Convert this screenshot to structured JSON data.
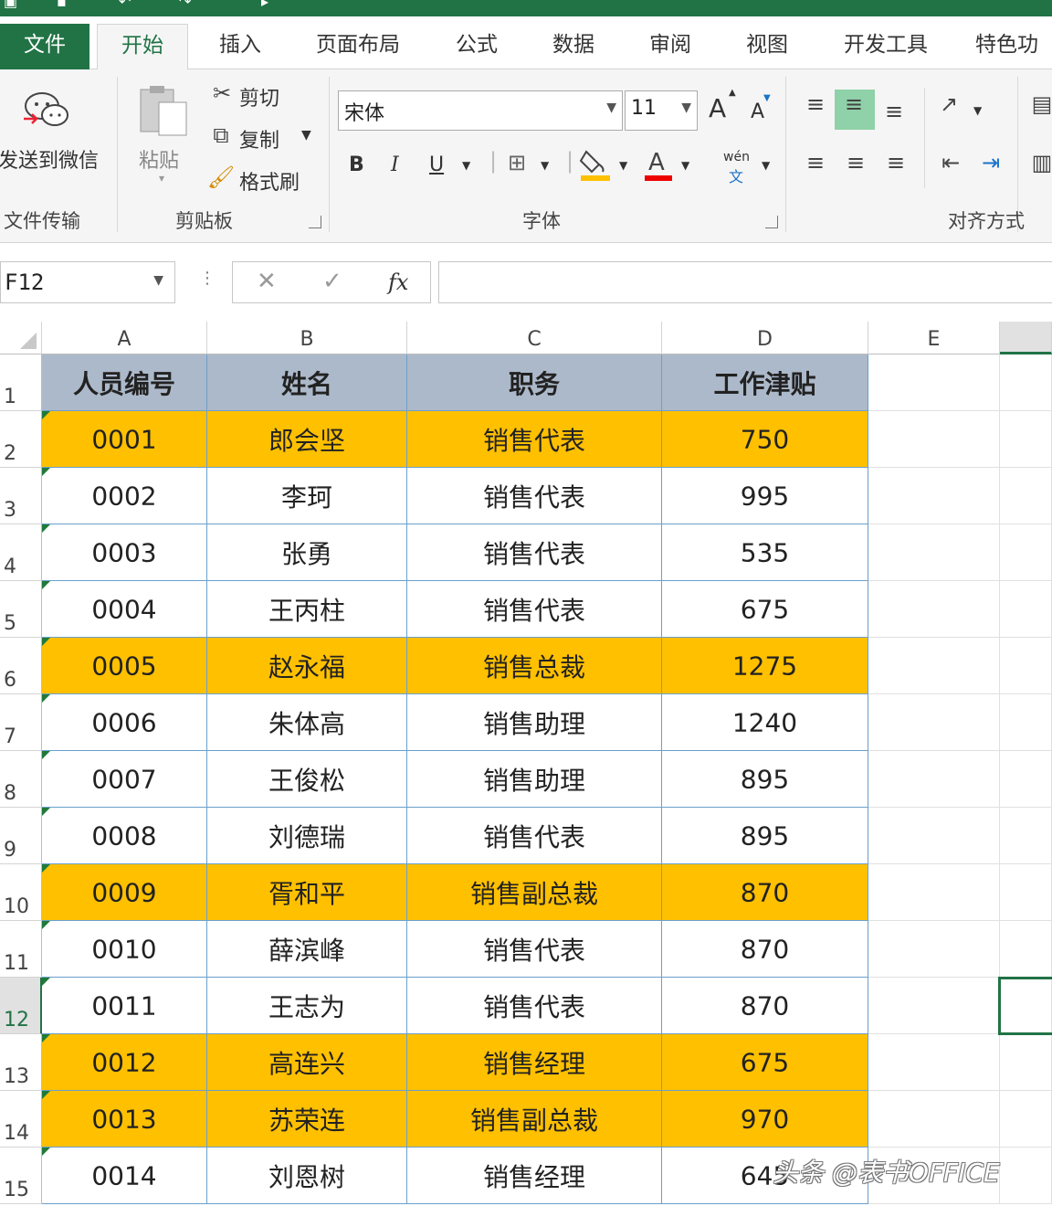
{
  "tabs": {
    "file": "文件",
    "items": [
      "开始",
      "插入",
      "页面布局",
      "公式",
      "数据",
      "审阅",
      "视图",
      "开发工具",
      "特色功"
    ]
  },
  "ribbon": {
    "wechat_label": "发送到微信",
    "wechat_group": "文件传输",
    "paste_label": "粘贴",
    "cut_label": "剪切",
    "copy_label": "复制",
    "format_painter_label": "格式刷",
    "clipboard_group": "剪贴板",
    "font_name": "宋体",
    "font_size": "11",
    "font_group": "字体",
    "align_group": "对齐方式",
    "bold": "B",
    "italic": "I",
    "underline": "U",
    "font_color_glyph": "A",
    "wen_label": "wén",
    "wen_char": "文",
    "grow_font": "A",
    "shrink_font": "A"
  },
  "formula_bar": {
    "name_box": "F12",
    "fx": "fx",
    "formula": ""
  },
  "columns": [
    "A",
    "B",
    "C",
    "D",
    "E"
  ],
  "rows": [
    "1",
    "2",
    "3",
    "4",
    "5",
    "6",
    "7",
    "8",
    "9",
    "10",
    "11",
    "12",
    "13",
    "14",
    "15"
  ],
  "table": {
    "headers": [
      "人员编号",
      "姓名",
      "职务",
      "工作津贴"
    ],
    "data": [
      {
        "id": "0001",
        "name": "郎会坚",
        "role": "销售代表",
        "allowance": "750",
        "highlight": true
      },
      {
        "id": "0002",
        "name": "李珂",
        "role": "销售代表",
        "allowance": "995",
        "highlight": false
      },
      {
        "id": "0003",
        "name": "张勇",
        "role": "销售代表",
        "allowance": "535",
        "highlight": false
      },
      {
        "id": "0004",
        "name": "王丙柱",
        "role": "销售代表",
        "allowance": "675",
        "highlight": false
      },
      {
        "id": "0005",
        "name": "赵永福",
        "role": "销售总裁",
        "allowance": "1275",
        "highlight": true
      },
      {
        "id": "0006",
        "name": "朱体高",
        "role": "销售助理",
        "allowance": "1240",
        "highlight": false
      },
      {
        "id": "0007",
        "name": "王俊松",
        "role": "销售助理",
        "allowance": "895",
        "highlight": false
      },
      {
        "id": "0008",
        "name": "刘德瑞",
        "role": "销售代表",
        "allowance": "895",
        "highlight": false
      },
      {
        "id": "0009",
        "name": "胥和平",
        "role": "销售副总裁",
        "allowance": "870",
        "highlight": true
      },
      {
        "id": "0010",
        "name": "薛滨峰",
        "role": "销售代表",
        "allowance": "870",
        "highlight": false
      },
      {
        "id": "0011",
        "name": "王志为",
        "role": "销售代表",
        "allowance": "870",
        "highlight": false
      },
      {
        "id": "0012",
        "name": "高连兴",
        "role": "销售经理",
        "allowance": "675",
        "highlight": true
      },
      {
        "id": "0013",
        "name": "苏荣连",
        "role": "销售副总裁",
        "allowance": "970",
        "highlight": true
      },
      {
        "id": "0014",
        "name": "刘恩树",
        "role": "销售经理",
        "allowance": "645",
        "highlight": false
      }
    ]
  },
  "colors": {
    "excel_green": "#217346",
    "header_fill": "#acb9ca",
    "highlight_fill": "#ffc000",
    "border_blue": "#6aa0cc"
  },
  "watermark": "头条 @表书OFFICE",
  "icons": {
    "wechat": "wechat-icon",
    "paste": "paste-icon",
    "cut": "scissors-icon",
    "copy": "copy-icon",
    "format_painter": "brush-icon",
    "fill_color": "paint-bucket-icon",
    "border": "border-icon",
    "cancel": "cancel-icon",
    "confirm": "check-icon"
  }
}
